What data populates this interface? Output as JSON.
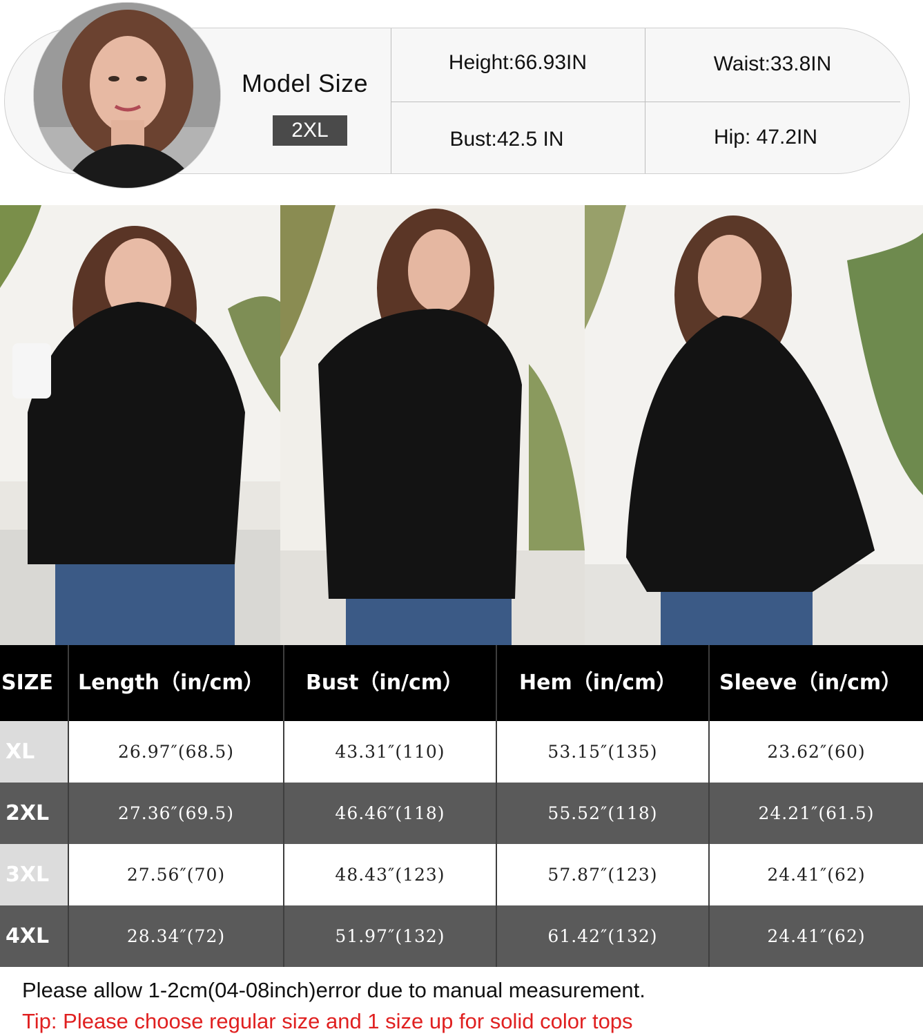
{
  "model_card": {
    "title": "Model Size",
    "size": "2XL",
    "height": "Height:66.93IN",
    "waist": "Waist:33.8IN",
    "bust": "Bust:42.5 IN",
    "hip": "Hip: 47.2IN"
  },
  "size_table": {
    "headers": [
      "SIZE",
      "Length（in/cm）",
      "Bust（in/cm）",
      "Hem（in/cm）",
      "Sleeve（in/cm）"
    ],
    "rows": [
      {
        "size": "XL",
        "length": "26.97″(68.5)",
        "bust": "43.31″(110)",
        "hem": "53.15″(135)",
        "sleeve": "23.62″(60)"
      },
      {
        "size": "2XL",
        "length": "27.36″(69.5)",
        "bust": "46.46″(118)",
        "hem": "55.52″(118)",
        "sleeve": "24.21″(61.5)"
      },
      {
        "size": "3XL",
        "length": "27.56″(70)",
        "bust": "48.43″(123)",
        "hem": "57.87″(123)",
        "sleeve": "24.41″(62)"
      },
      {
        "size": "4XL",
        "length": "28.34″(72)",
        "bust": "51.97″(132)",
        "hem": "61.42″(132)",
        "sleeve": "24.41″(62)"
      }
    ]
  },
  "notes": {
    "error_note": "Please allow 1-2cm(04-08inch)error due to manual measurement.",
    "tip": "Tip: Please choose regular size and 1 size up for solid color tops"
  },
  "colors": {
    "header_bg": "#000000",
    "dark_row": "#5a5a5a",
    "light_size_cell": "#dcdcdc",
    "tip_text": "#e02020",
    "garment": "#111111",
    "denim": "#3b5a86"
  }
}
